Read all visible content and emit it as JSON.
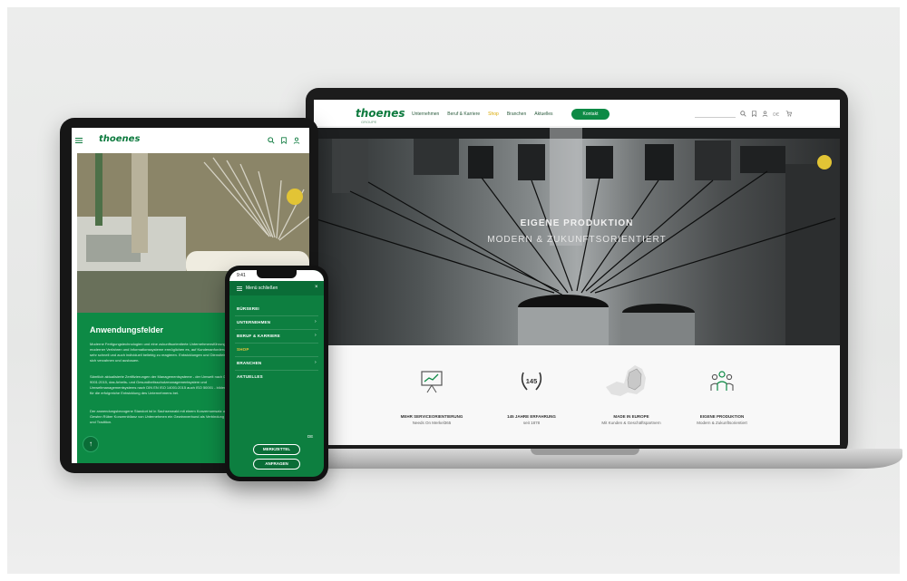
{
  "laptop": {
    "logo": "thoenes",
    "logo_sub": "GROUPE",
    "nav": [
      "Unternehmen",
      "Beruf & Karriere",
      "Shop",
      "Branchen",
      "Aktuelles"
    ],
    "contact_label": "Kontakt",
    "hero": {
      "title": "EIGENE PRODUKTION",
      "subtitle": "MODERN & ZUKUNFTSORIENTIERT"
    },
    "features": [
      {
        "title": "MEHR SERVICEORIENTIERUNG",
        "text": "Needs On Merkel365",
        "icon": "presentation-chart-icon"
      },
      {
        "title": "145 JAHRE ERFAHRUNG",
        "text": "seit 1878",
        "icon": "laurel-145-icon",
        "badge": "145"
      },
      {
        "title": "MADE IN EUROPE",
        "text": "Mit Kunden & Geschäftspartnern",
        "icon": "map-europe-icon"
      },
      {
        "title": "EIGENE PRODUKTION",
        "text": "Modern & Zukunftsorientiert",
        "icon": "team-people-icon"
      }
    ],
    "accent": "#0d8a45",
    "highlight": "#d9a800"
  },
  "tablet": {
    "logo": "thoenes",
    "section_title": "Anwendungsfelder",
    "paragraphs": [
      "Moderne Fertigungstechnologien und eine zukunftsorientierte Unternehmensführung. Nutzung moderner Verfahren und Informationssysteme ermöglichen es, auf Kundenanforderungen gezielt und sehr schnell und auch individuell beliebig zu reagieren. Entwicklungen und Dienstleistungen lassen sich verzahnen und ausbauen.",
      "Sämtlich aktualisierte Zertifizierungen der Managementsysteme - der Umwelt nach DIN EN ISO 9001:2015, das Arbeits- und Gesundheitsschutzmanagementsystem und Umweltmanagementsystems nach DIN EN ISO 14001:2015 auch ISO 50001 - bilden die Grundlage für die erfolgreiche Entwicklung des Unternehmens bei.",
      "Der anwendungsbezogene Standort ist in Sachsenwald mit einem Konzernumsatz und 5 Jahren Gewinn Rüber Konzernbilanz von Unternehmen ein Gewinnverbund als Verbindung von Innovation und Tradition."
    ],
    "fab_icon": "arrow-up-icon"
  },
  "phone": {
    "time": "9:41",
    "menu_close_label": "Menü schließen",
    "menu_items": [
      {
        "label": "BÜRSEREI",
        "has_arrow": false
      },
      {
        "label": "UNTERNEHMEN",
        "has_arrow": true
      },
      {
        "label": "BERUF & KARRIERE",
        "has_arrow": true
      },
      {
        "label": "SHOP",
        "has_arrow": false
      },
      {
        "label": "BRANCHEN",
        "has_arrow": true
      },
      {
        "label": "AKTUELLES",
        "has_arrow": false
      }
    ],
    "language": "DE",
    "buttons": [
      "MERKZETTEL",
      "ANFRAGEN"
    ]
  }
}
